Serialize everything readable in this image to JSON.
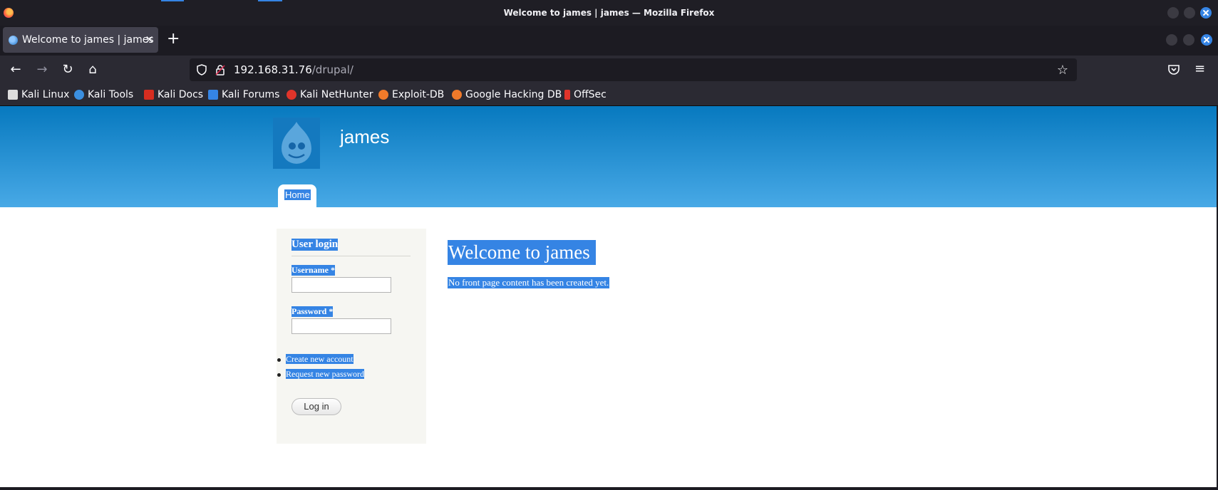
{
  "window": {
    "title": "Welcome to james | james — Mozilla Firefox"
  },
  "tab": {
    "title": "Welcome to james | james",
    "close_glyph": "×",
    "new_tab_glyph": "+"
  },
  "nav": {
    "back_glyph": "←",
    "forward_glyph": "→",
    "reload_glyph": "↻",
    "home_glyph": "⌂",
    "url_host": "192.168.31.76",
    "url_path": "/drupal/",
    "star_glyph": "☆",
    "menu_glyph": "≡"
  },
  "bookmarks": [
    {
      "label": "Kali Linux",
      "icon": "kali-dragon-icon",
      "color": "#ffffff"
    },
    {
      "label": "Kali Tools",
      "icon": "kali-tools-icon",
      "color": "#3b8fe0"
    },
    {
      "label": "Kali Docs",
      "icon": "kali-docs-icon",
      "color": "#d62d20"
    },
    {
      "label": "Kali Forums",
      "icon": "kali-forums-icon",
      "color": "#3584e4"
    },
    {
      "label": "Kali NetHunter",
      "icon": "nethunter-icon",
      "color": "#e0342a"
    },
    {
      "label": "Exploit-DB",
      "icon": "exploit-db-icon",
      "color": "#f07a2a"
    },
    {
      "label": "Google Hacking DB",
      "icon": "ghdb-icon",
      "color": "#f07a2a"
    },
    {
      "label": "OffSec",
      "icon": "offsec-icon",
      "color": "#e0342a"
    }
  ],
  "site": {
    "name": "james",
    "nav_home": "Home"
  },
  "login": {
    "heading": "User login",
    "username_label": "Username *",
    "password_label": "Password *",
    "username_value": "",
    "password_value": "",
    "links": [
      "Create new account",
      "Request new password"
    ],
    "button": "Log in"
  },
  "content": {
    "title": "Welcome to james",
    "message": "No front page content has been created yet."
  },
  "colors": {
    "selection": "#3584e4",
    "header_top": "#0779bf",
    "header_bottom": "#48a9e6"
  }
}
